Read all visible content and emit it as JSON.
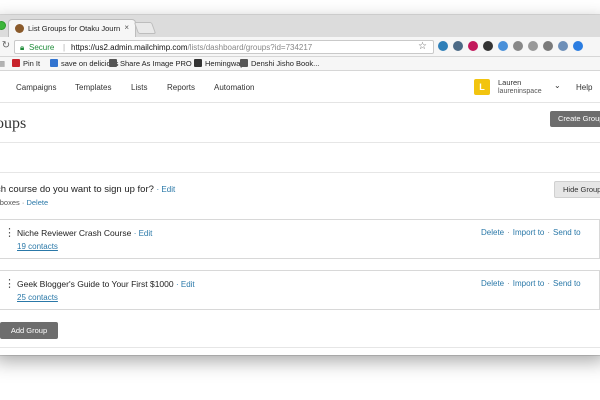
{
  "browser": {
    "tab_title": "List Groups for Otaku Journalist",
    "tab_close": "×",
    "secure_label": "Secure",
    "url_domain": "https://us2.admin.mailchimp.com",
    "url_path": "/lists/dashboard/groups?id=734217",
    "extensions": [
      "#2f7fb8",
      "#4c6a86",
      "#c2185b",
      "#333333",
      "#4a90d9",
      "#888888",
      "#999999",
      "#7a7a7a",
      "#6e8fb8",
      "#2b7de1"
    ]
  },
  "bookmarks": [
    {
      "label": "Pin It",
      "icon_color": "#c8232c"
    },
    {
      "label": "save on delicious",
      "icon_color": "#3274d0"
    },
    {
      "label": "Share As Image PRO",
      "icon_color": "#555555"
    },
    {
      "label": "Hemingway",
      "icon_color": "#333333"
    },
    {
      "label": "Denshi Jisho Book...",
      "icon_color": "#555555"
    }
  ],
  "nav": {
    "items": [
      "Campaigns",
      "Templates",
      "Lists",
      "Reports",
      "Automation"
    ],
    "user_initial": "L",
    "user_name": "Lauren",
    "user_handle": "laureninspace",
    "help": "Help"
  },
  "page": {
    "title": "oups",
    "create_group": "Create Group",
    "question": "ch course do you want to sign up for?",
    "question_edit": "· Edit",
    "meta_type": "kboxes",
    "meta_sep": "·",
    "meta_delete": "Delete",
    "hide_groups": "Hide Group",
    "add_group": "Add Group"
  },
  "groups": [
    {
      "name": "Niche Reviewer Crash Course",
      "edit": "· Edit",
      "count": "19 contacts"
    },
    {
      "name": "Geek Blogger's Guide to Your First $1000",
      "edit": "· Edit",
      "count": "25 contacts"
    }
  ],
  "group_actions": {
    "delete": "Delete",
    "import": "Import to",
    "send": "Send to",
    "dot": "·"
  },
  "colors": {
    "link": "#2a78a8",
    "avatar": "#f2c40f",
    "button_dark": "#6d6d6d",
    "secure": "#1f8c3a"
  }
}
